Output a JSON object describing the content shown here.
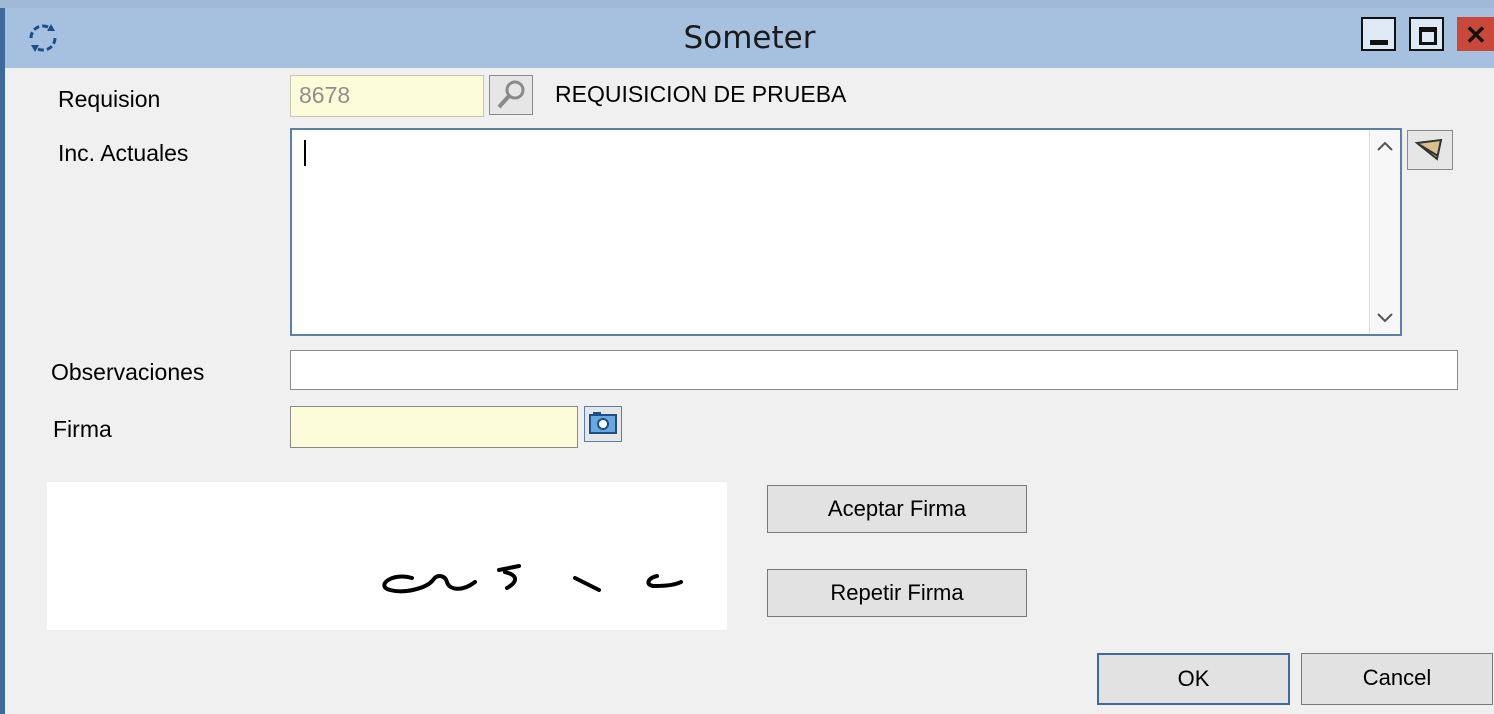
{
  "window": {
    "title": "Someter"
  },
  "form": {
    "requisicion_label": "Requision",
    "requisicion_value": "8678",
    "requisicion_desc": "REQUISICION DE PRUEBA",
    "inc_actuales_label": "Inc. Actuales",
    "inc_actuales_value": "",
    "observaciones_label": "Observaciones",
    "observaciones_value": "",
    "firma_label": "Firma",
    "firma_value": ""
  },
  "buttons": {
    "aceptar_firma": "Aceptar Firma",
    "repetir_firma": "Repetir Firma",
    "ok": "OK",
    "cancel": "Cancel"
  },
  "icons": {
    "app": "refresh-icon",
    "requisicion_lookup": "magnifier-icon",
    "inc_actuales_action": "edit-icon",
    "firma_capture": "camera-icon"
  },
  "colors": {
    "titlebar": "#a6c1e0",
    "readonly_field": "#fdfcd8",
    "close_button": "#c9483a"
  }
}
